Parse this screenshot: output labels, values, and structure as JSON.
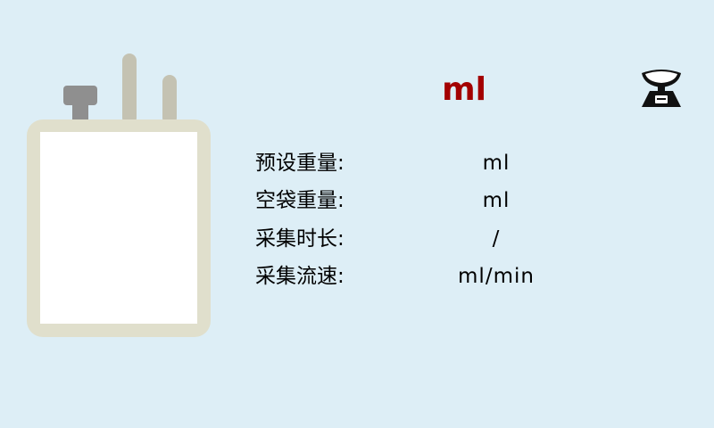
{
  "colors": {
    "background": "#ddeef6",
    "weight_text": "#a30000",
    "bag_frame": "#e0dfcc",
    "bag_window": "#ffffff",
    "tube": "#c4c2b2",
    "cap": "#8f8f8f",
    "icon": "#111111"
  },
  "header": {
    "weight_unit": "ml"
  },
  "icons": {
    "bag": "blood-bag-icon",
    "scale": "weighing-scale-icon"
  },
  "info": {
    "rows": [
      {
        "label": "预设重量:",
        "value": "ml"
      },
      {
        "label": "空袋重量:",
        "value": "ml"
      },
      {
        "label": "采集时长:",
        "value": "/"
      },
      {
        "label": "采集流速:",
        "value": "ml/min"
      }
    ]
  }
}
